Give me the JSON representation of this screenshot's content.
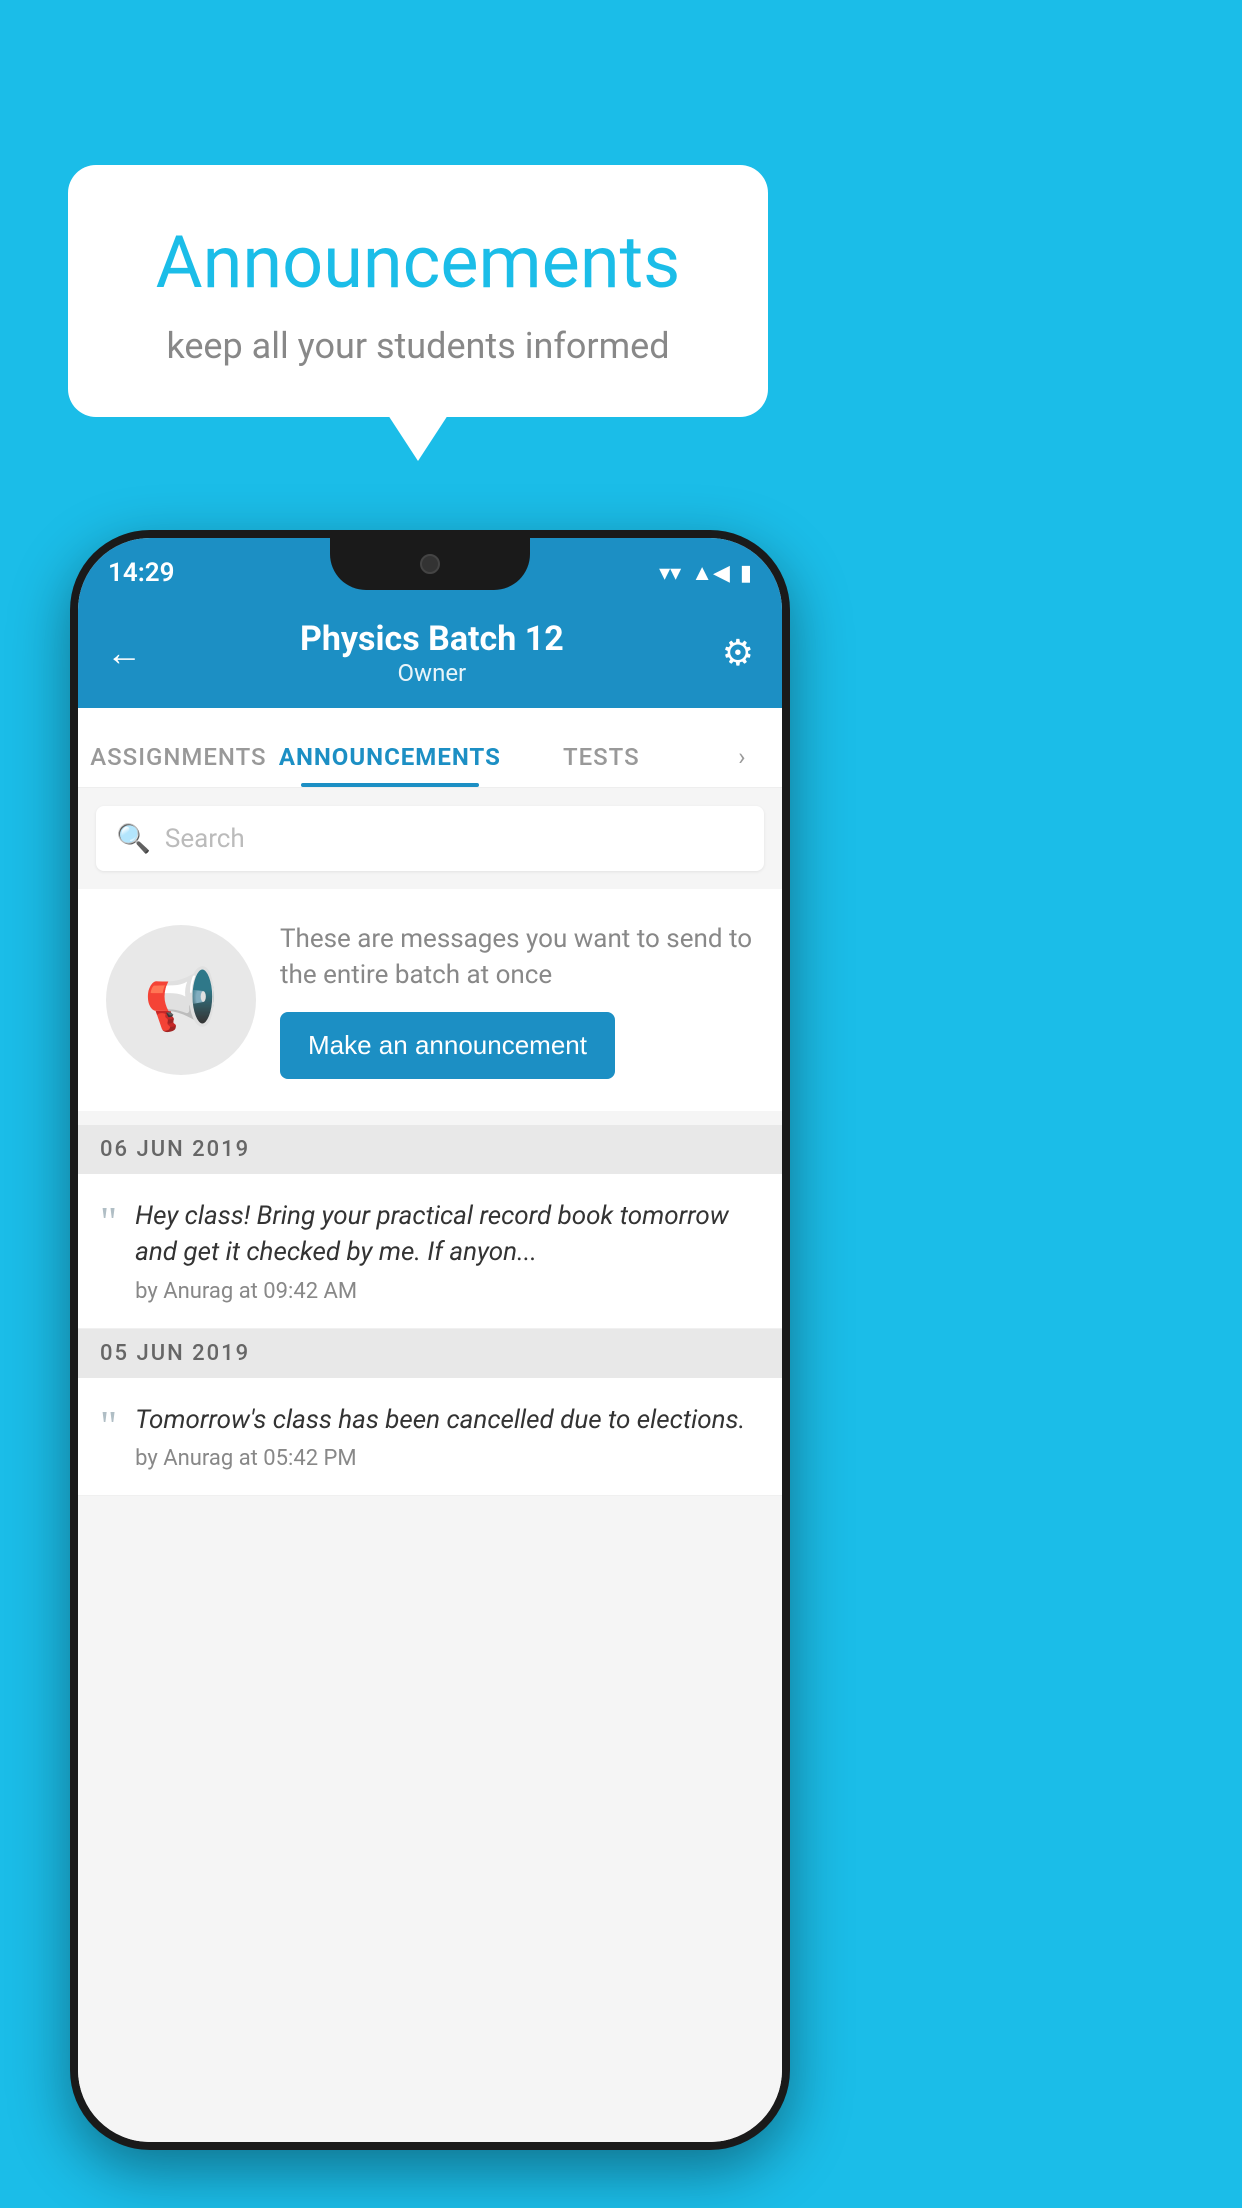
{
  "page": {
    "background_color": "#1bbde8"
  },
  "speech_bubble": {
    "title": "Announcements",
    "subtitle": "keep all your students informed"
  },
  "status_bar": {
    "time": "14:29",
    "wifi": "▼",
    "signal": "▲",
    "battery": "▮"
  },
  "header": {
    "title": "Physics Batch 12",
    "subtitle": "Owner",
    "back_label": "←",
    "gear_label": "⚙"
  },
  "tabs": [
    {
      "label": "ASSIGNMENTS",
      "active": false
    },
    {
      "label": "ANNOUNCEMENTS",
      "active": true
    },
    {
      "label": "TESTS",
      "active": false
    }
  ],
  "search": {
    "placeholder": "Search"
  },
  "announcement_empty": {
    "description": "These are messages you want to send to the entire batch at once",
    "button_label": "Make an announcement"
  },
  "date_sections": [
    {
      "date": "06  JUN  2019",
      "items": [
        {
          "message": "Hey class! Bring your practical record book tomorrow and get it checked by me. If anyon...",
          "meta": "by Anurag at 09:42 AM"
        }
      ]
    },
    {
      "date": "05  JUN  2019",
      "items": [
        {
          "message": "Tomorrow's class has been cancelled due to elections.",
          "meta": "by Anurag at 05:42 PM"
        }
      ]
    }
  ]
}
